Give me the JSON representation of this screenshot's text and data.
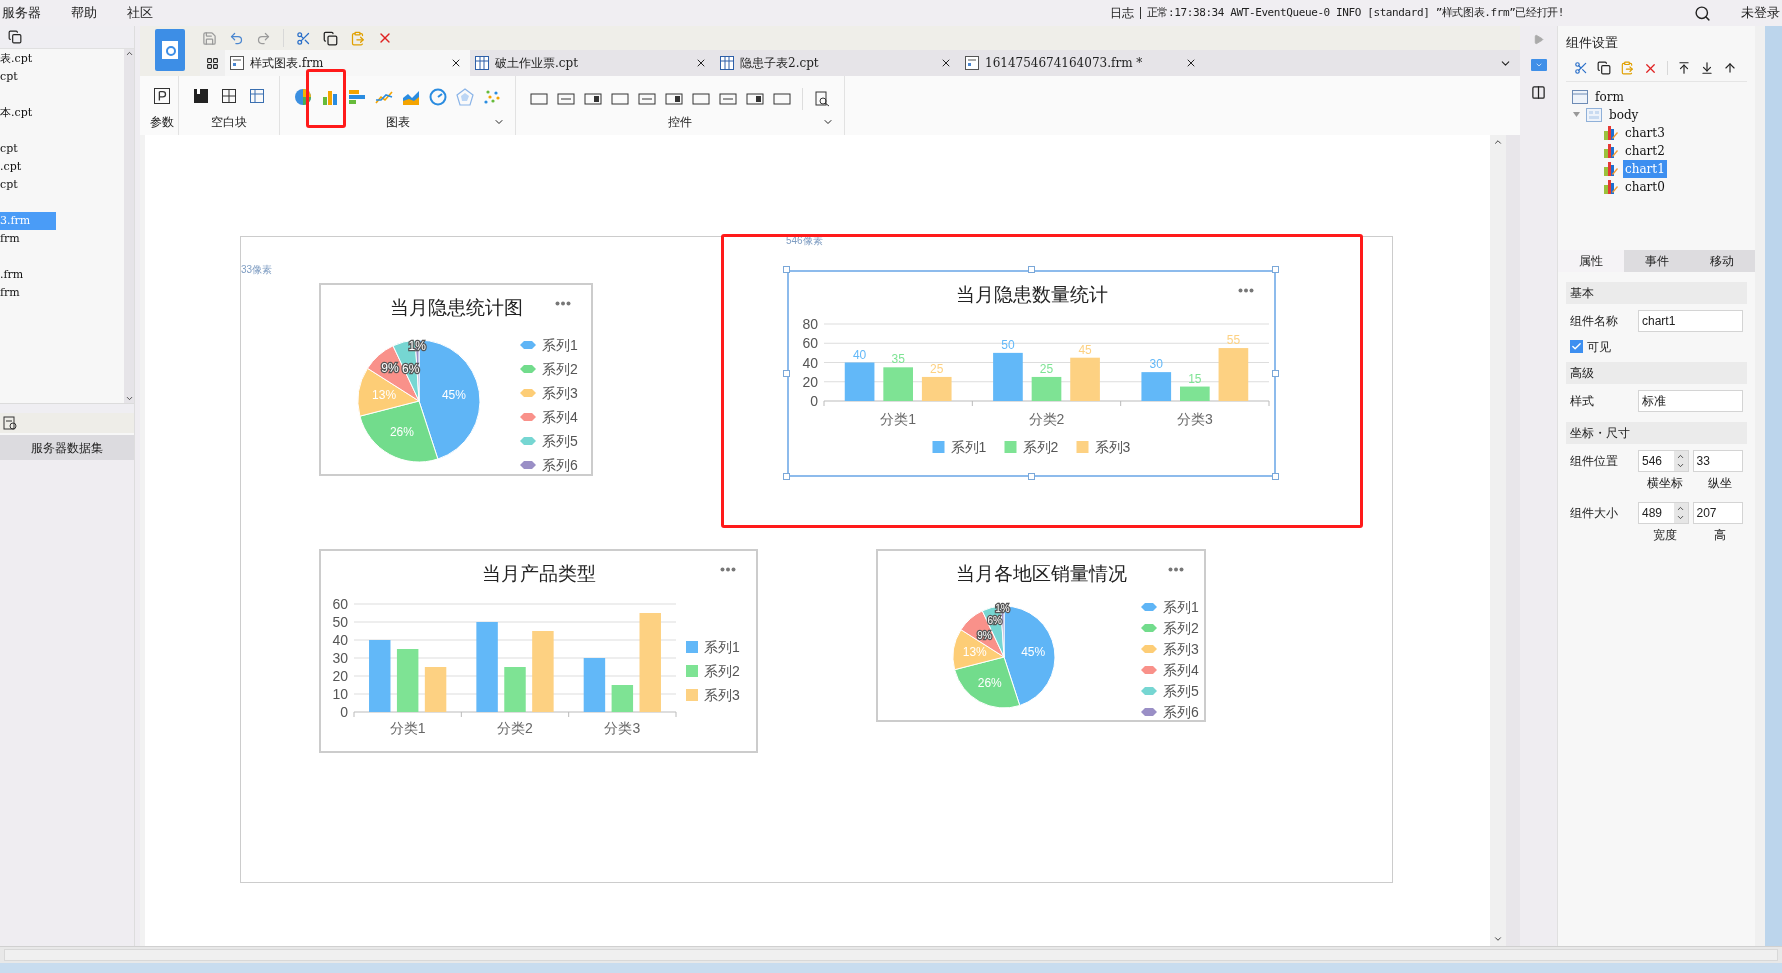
{
  "menu": [
    {
      "label": "服务器"
    },
    {
      "label": "帮助"
    },
    {
      "label": "社区"
    }
  ],
  "status": {
    "label": "日志",
    "message": "正常:17:38:34 AWT-EventQueue-0 INFO [standard] ”样式图表.frm”已经打开!"
  },
  "user": "未登录",
  "file_list": [
    {
      "name": "表.cpt",
      "selected": false
    },
    {
      "name": "cpt",
      "selected": false
    },
    {
      "name": "本.cpt",
      "selected": false
    },
    {
      "name": "cpt",
      "selected": false
    },
    {
      "name": ".cpt",
      "selected": false
    },
    {
      "name": "cpt",
      "selected": false
    },
    {
      "name": "3.frm",
      "selected": true
    },
    {
      "name": "frm",
      "selected": false
    },
    {
      "name": ".frm",
      "selected": false
    },
    {
      "name": "frm",
      "selected": false
    }
  ],
  "data_tab": "服务器数据集",
  "tabs": [
    {
      "label": "样式图表.frm",
      "kind": "frm",
      "selected": true
    },
    {
      "label": "破土作业票.cpt",
      "kind": "cpt",
      "selected": false
    },
    {
      "label": "隐患子表2.cpt",
      "kind": "cpt",
      "selected": false
    },
    {
      "label": "1614754674164073.frm *",
      "kind": "frm",
      "selected": false
    }
  ],
  "palette": {
    "groups": [
      {
        "kind": "param",
        "label": "参数"
      },
      {
        "kind": "blank",
        "label": "空白块"
      },
      {
        "kind": "chart",
        "label": "图表",
        "tools": [
          {
            "kind": "pie",
            "highlighted": false
          },
          {
            "kind": "bar",
            "highlighted": true
          },
          {
            "kind": "hbar",
            "highlighted": false
          },
          {
            "kind": "line",
            "highlighted": false
          },
          {
            "kind": "area",
            "highlighted": false
          },
          {
            "kind": "gauge",
            "highlighted": false
          },
          {
            "kind": "radar",
            "highlighted": false
          },
          {
            "kind": "scatter",
            "highlighted": false
          }
        ]
      },
      {
        "kind": "widget",
        "label": "控件"
      }
    ]
  },
  "canvas": {
    "x_guide": "546像素",
    "y_guide": "33像素",
    "widgets": [
      {
        "selected": false,
        "highlighted": false,
        "chart_data": {
          "type": "pie",
          "title": "当月隐患统计图",
          "legend": true,
          "categories": [
            "系列1",
            "系列2",
            "系列3",
            "系列4",
            "系列5",
            "系列6"
          ],
          "values": [
            45,
            26,
            13,
            9,
            6,
            1
          ],
          "colors": [
            "#5fb5f6",
            "#72dc8c",
            "#fdcd76",
            "#f9918a",
            "#76d6d2",
            "#9a8fc6"
          ],
          "value_labels": [
            "45%",
            "26%",
            "13%",
            "9%",
            "6%",
            "1%"
          ]
        }
      },
      {
        "selected": true,
        "highlighted": true,
        "chart_data": {
          "type": "bar",
          "title": "当月隐患数量统计",
          "legend": true,
          "grid": true,
          "categories": [
            "分类1",
            "分类2",
            "分类3"
          ],
          "series": [
            {
              "name": "系列1",
              "color": "#62b8f8",
              "values": [
                40,
                50,
                30
              ]
            },
            {
              "name": "系列2",
              "color": "#7ee394",
              "values": [
                35,
                25,
                15
              ]
            },
            {
              "name": "系列3",
              "color": "#fdd182",
              "values": [
                25,
                45,
                55
              ]
            }
          ],
          "ylim": [
            0,
            80
          ],
          "yticks": [
            0,
            20,
            40,
            60,
            80
          ],
          "data_labels": true
        }
      },
      {
        "selected": false,
        "highlighted": false,
        "chart_data": {
          "type": "bar",
          "title": "当月产品类型",
          "legend": true,
          "grid": true,
          "categories": [
            "分类1",
            "分类2",
            "分类3"
          ],
          "series": [
            {
              "name": "系列1",
              "color": "#62b8f8",
              "values": [
                40,
                50,
                30
              ]
            },
            {
              "name": "系列2",
              "color": "#7ee394",
              "values": [
                35,
                25,
                15
              ]
            },
            {
              "name": "系列3",
              "color": "#fdd182",
              "values": [
                25,
                45,
                55
              ]
            }
          ],
          "ylim": [
            0,
            60
          ],
          "yticks": [
            0,
            10,
            20,
            30,
            40,
            50,
            60
          ],
          "data_labels": false
        }
      },
      {
        "selected": false,
        "highlighted": false,
        "chart_data": {
          "type": "pie",
          "title": "当月各地区销量情况",
          "legend": true,
          "categories": [
            "系列1",
            "系列2",
            "系列3",
            "系列4",
            "系列5",
            "系列6"
          ],
          "values": [
            45,
            26,
            13,
            9,
            6,
            1
          ],
          "colors": [
            "#5fb5f6",
            "#72dc8c",
            "#fdcd76",
            "#f9918a",
            "#76d6d2",
            "#9a8fc6"
          ],
          "value_labels": [
            "45%",
            "26%",
            "13%",
            "9%",
            "6%",
            "1%"
          ]
        }
      }
    ]
  },
  "panel": {
    "title": "组件设置",
    "tree": {
      "label": "form",
      "selected": false,
      "children": [
        {
          "label": "body",
          "selected": false,
          "expanded": true,
          "children": [
            {
              "label": "chart3",
              "selected": false
            },
            {
              "label": "chart2",
              "selected": false
            },
            {
              "label": "chart1",
              "selected": true
            },
            {
              "label": "chart0",
              "selected": false
            }
          ]
        }
      ]
    },
    "tabs": [
      {
        "label": "属性",
        "selected": true
      },
      {
        "label": "事件",
        "selected": false
      },
      {
        "label": "移动",
        "selected": false
      }
    ],
    "basic": {
      "heading": "基本",
      "name_label": "组件名称",
      "name_value": "chart1",
      "visible_label": "可见",
      "visible_checked": true
    },
    "advanced": {
      "heading": "高级",
      "style_label": "样式",
      "style_value": "标准"
    },
    "geometry": {
      "heading": "坐标・尺寸",
      "position_label": "组件位置",
      "x_value": "546",
      "y_value": "33",
      "x_caption": "横坐标",
      "y_caption": "纵坐",
      "size_label": "组件大小",
      "w_value": "489",
      "h_value": "207",
      "w_caption": "宽度",
      "h_caption": "高"
    }
  }
}
